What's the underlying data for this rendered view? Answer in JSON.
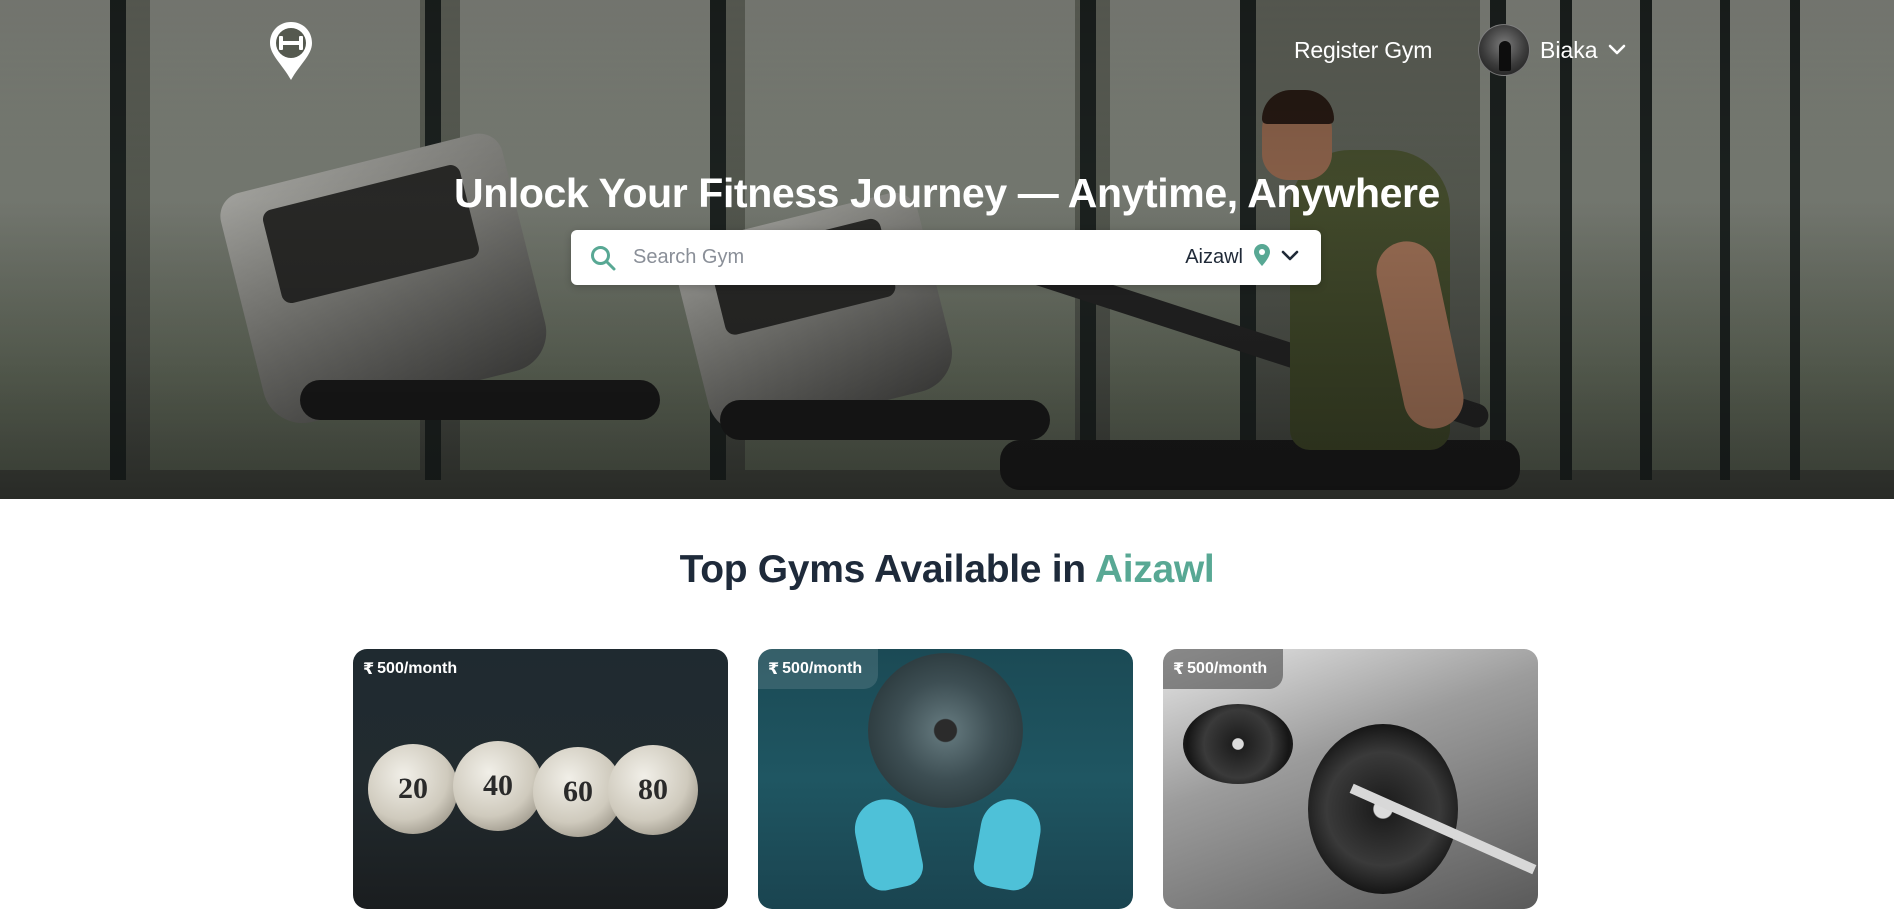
{
  "header": {
    "logo_icon": "dumbbell-location-pin-icon",
    "register_label": "Register Gym",
    "user": {
      "name": "Biaka",
      "avatar_icon": "user-avatar"
    }
  },
  "hero": {
    "title": "Unlock Your Fitness Journey — Anytime, Anywhere",
    "search": {
      "placeholder": "Search Gym",
      "value": "",
      "location": "Aizawl",
      "location_icon": "map-pin-icon",
      "dropdown_icon": "chevron-down-icon"
    }
  },
  "section": {
    "title_prefix": "Top Gyms Available in",
    "title_city": "Aizawl"
  },
  "gyms": [
    {
      "price_symbol": "₹",
      "price": "500/month"
    },
    {
      "price_symbol": "₹",
      "price": "500/month"
    },
    {
      "price_symbol": "₹",
      "price": "500/month"
    }
  ],
  "colors": {
    "accent": "#58a894",
    "heading": "#1e2a3a"
  }
}
